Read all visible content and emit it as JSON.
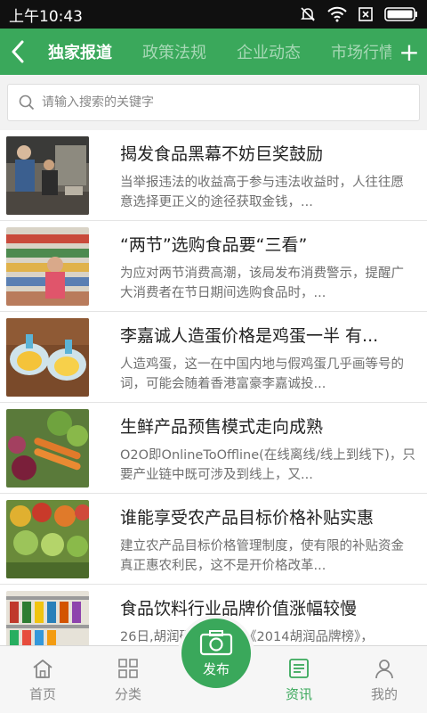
{
  "status_bar": {
    "time": "上午10:43"
  },
  "nav": {
    "tabs": [
      "独家报道",
      "政策法规",
      "企业动态",
      "市场行情"
    ],
    "add_label": "+"
  },
  "search": {
    "placeholder": "请输入搜索的关键字"
  },
  "articles": [
    {
      "title": "揭发食品黑幕不妨巨奖鼓励",
      "desc": "当举报违法的收益高于参与违法收益时，人往往愿意选择更正义的途径获取金钱，..."
    },
    {
      "title": "“两节”选购食品要“三看”",
      "desc": "为应对两节消费高潮，该局发布消费警示，提醒广大消费者在节日期间选购食品时，..."
    },
    {
      "title": "李嘉诚人造蛋价格是鸡蛋一半 有...",
      "desc": "人造鸡蛋，这一在中国内地与假鸡蛋几乎画等号的词，可能会随着香港富豪李嘉诚投..."
    },
    {
      "title": "生鲜产品预售模式走向成熟",
      "desc": "O2O即OnlineToOffline(在线离线/线上到线下)，只要产业链中既可涉及到线上，又..."
    },
    {
      "title": "谁能享受农产品目标价格补贴实惠",
      "desc": "建立农产品目标价格管理制度，使有限的补贴资金真正惠农利民，这不是开价格改革..."
    },
    {
      "title": "食品饮料行业品牌价值涨幅较慢",
      "desc": "26日,胡润研究院发布《2014胡润品牌榜》，"
    }
  ],
  "bottom_nav": {
    "home": "首页",
    "category": "分类",
    "publish": "发布",
    "news": "资讯",
    "mine": "我的"
  },
  "colors": {
    "accent": "#3aa85b",
    "status_bg": "#101010"
  }
}
